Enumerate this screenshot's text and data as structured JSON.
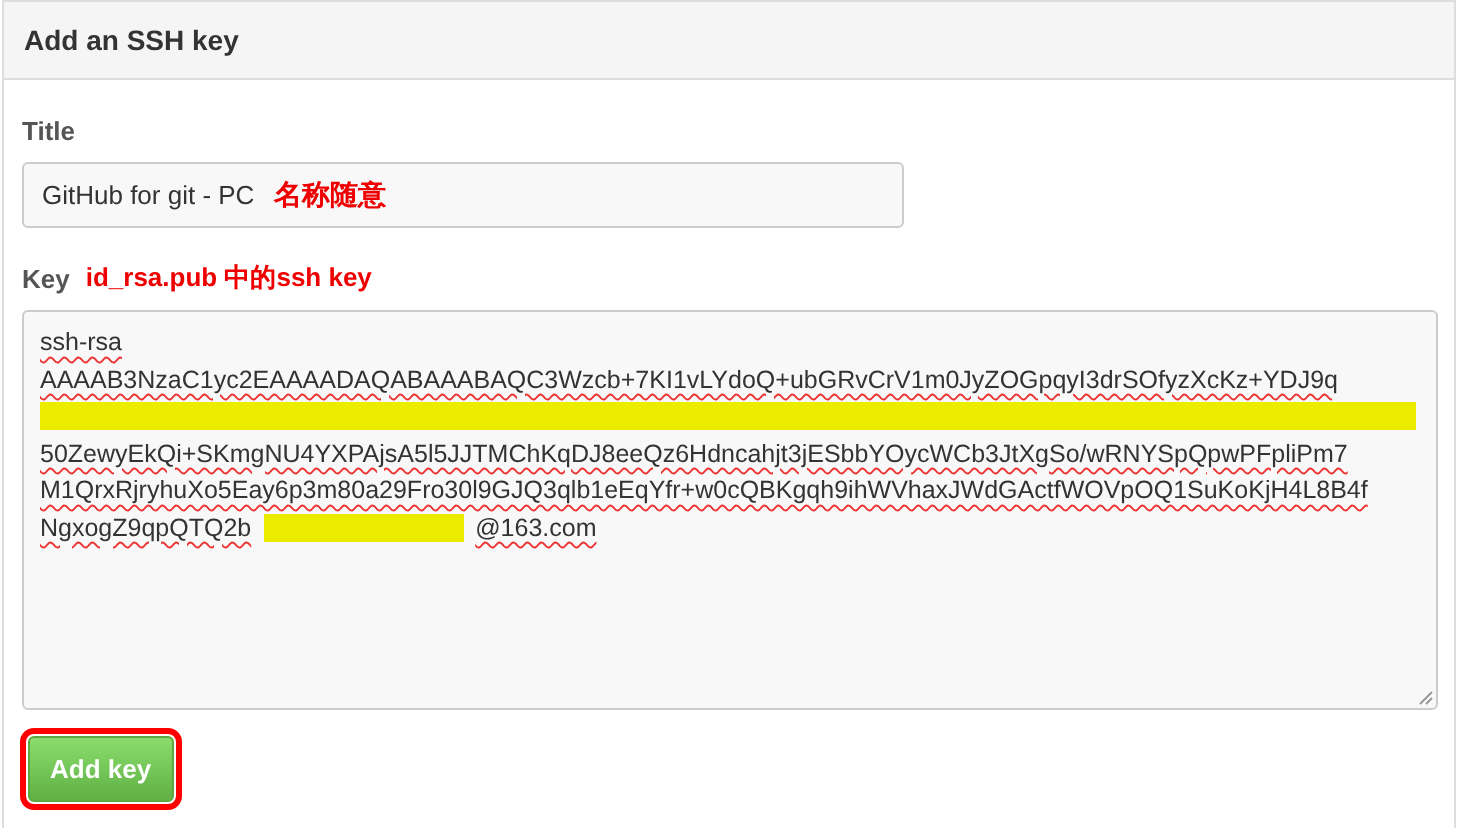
{
  "panel": {
    "title": "Add an SSH key"
  },
  "title_field": {
    "label": "Title",
    "value": "GitHub for git - PC",
    "annotation": "名称随意"
  },
  "key_field": {
    "label": "Key",
    "annotation": "id_rsa.pub 中的ssh key",
    "lines": [
      [
        {
          "kind": "text",
          "text": "ssh-rsa"
        }
      ],
      [
        {
          "kind": "text",
          "text": "AAAAB3NzaC1yc2EAAAADAQABAAABAQC3Wzcb+7KI1vLYdoQ+ubGRvCrV1m0JyZOGpqyI3drSOfyzXcKz+YDJ9q"
        }
      ],
      [
        {
          "kind": "redacted"
        }
      ],
      [
        {
          "kind": "text",
          "text": "50ZewyEkQi+SKmgNU4YXPAjsA5l5JJTMChKqDJ8eeQz6Hdncahjt3jESbbYOycWCb3JtXgSo/wRNYSpQpwPFpliPm7"
        }
      ],
      [
        {
          "kind": "text",
          "text": "M1QrxRjryhuXo5Eay6p3m80a29Fro30l9GJQ3qlb1eEqYfr+w0cQBKgqh9ihWVhaxJWdGActfWOVpOQ1SuKoKjH4L8B4f"
        }
      ],
      [
        {
          "kind": "text",
          "text": "NgxogZ9qpQTQ2b"
        },
        {
          "kind": "redacted"
        },
        {
          "kind": "text",
          "text": "@163.com"
        }
      ]
    ]
  },
  "submit": {
    "label": "Add key",
    "highlighted": true
  }
}
